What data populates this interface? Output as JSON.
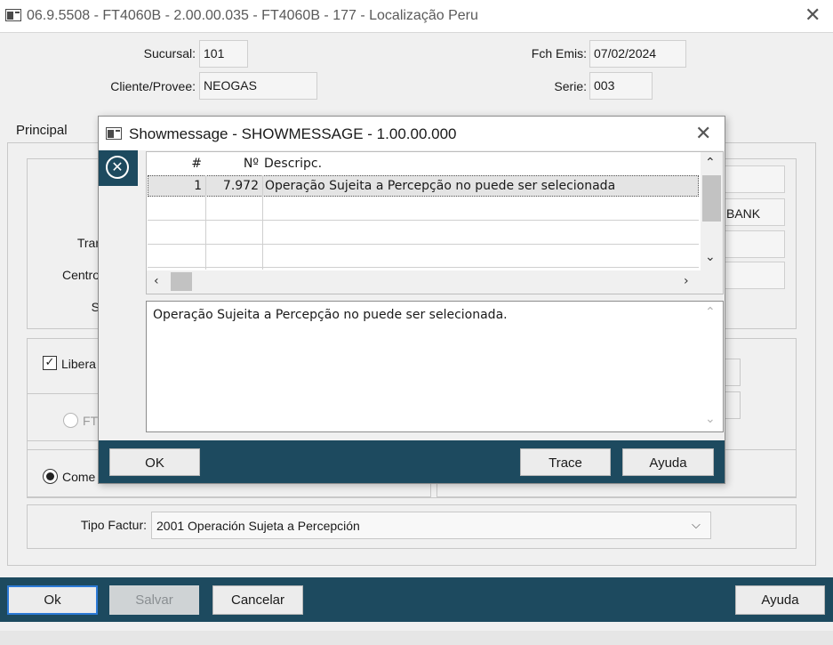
{
  "window": {
    "title": "06.9.5508 - FT4060B - 2.00.00.035 - FT4060B - 177 - Localização Peru",
    "close_icon": "close-icon"
  },
  "header": {
    "sucursal_label": "Sucursal:",
    "sucursal_value": "101",
    "fch_emis_label": "Fch Emis:",
    "fch_emis_value": "07/02/2024",
    "cliente_label": "Cliente/Provee:",
    "cliente_value": "NEOGAS",
    "serie_label": "Serie:",
    "serie_value": "003"
  },
  "tabs": {
    "principal": "Principal"
  },
  "partial": {
    "tran": "Trar",
    "centro": "Centro",
    "s": "S",
    "bank": "BANK",
    "libera_label": "Libera",
    "libera_checked": true,
    "ft_label": "FT",
    "come_label": "Come"
  },
  "tipo_factur": {
    "label": "Tipo Factur:",
    "value": "2001 Operación Sujeta a Percepción"
  },
  "footer": {
    "ok": "Ok",
    "salvar": "Salvar",
    "cancelar": "Cancelar",
    "ayuda": "Ayuda"
  },
  "dialog": {
    "title": "Showmessage - SHOWMESSAGE - 1.00.00.000",
    "icon": "error-circle-icon",
    "grid": {
      "headers": [
        "#",
        "Nº",
        "Descripc."
      ],
      "rows": [
        [
          "1",
          "7.972",
          "Operação Sujeita a Percepção no puede ser selecionada"
        ]
      ]
    },
    "message": "Operação Sujeita a Percepção no puede ser selecionada.",
    "buttons": {
      "ok": "OK",
      "trace": "Trace",
      "ayuda": "Ayuda"
    }
  },
  "colors": {
    "bar": "#1d4a5f",
    "focus": "#2d7ad6"
  }
}
